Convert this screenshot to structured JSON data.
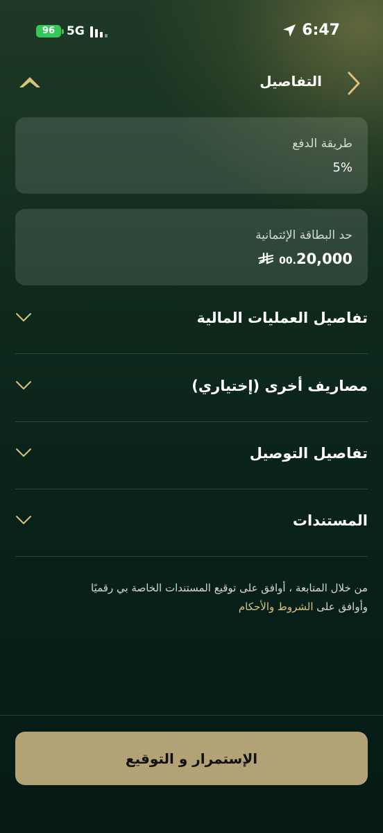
{
  "status_bar": {
    "battery": "96",
    "network": "5G",
    "time": "6:47"
  },
  "header": {
    "title": "التفاصيل"
  },
  "cards": [
    {
      "label": "طريقة الدفع",
      "value": "5%"
    },
    {
      "label": "حد البطاقة الإئتمانية",
      "amount_main": "20,000",
      "amount_decimal": ".00"
    }
  ],
  "sections": [
    {
      "label": "تفاصيل العمليات المالية"
    },
    {
      "label": "مصاريف أخرى (إختياري)"
    },
    {
      "label": "تفاصيل التوصيل"
    },
    {
      "label": "المستندات"
    }
  ],
  "consent": {
    "line1": "من خلال المتابعة ، أوافق على توقيع المستندات الخاصة بي رقميًا",
    "line2_prefix": "وأوافق على ",
    "link": "الشروط والأحكام"
  },
  "footer": {
    "continue_label": "الإستمرار و التوقيع"
  },
  "colors": {
    "accent": "#d8c47a",
    "button": "#b3a275",
    "battery": "#34c759"
  }
}
